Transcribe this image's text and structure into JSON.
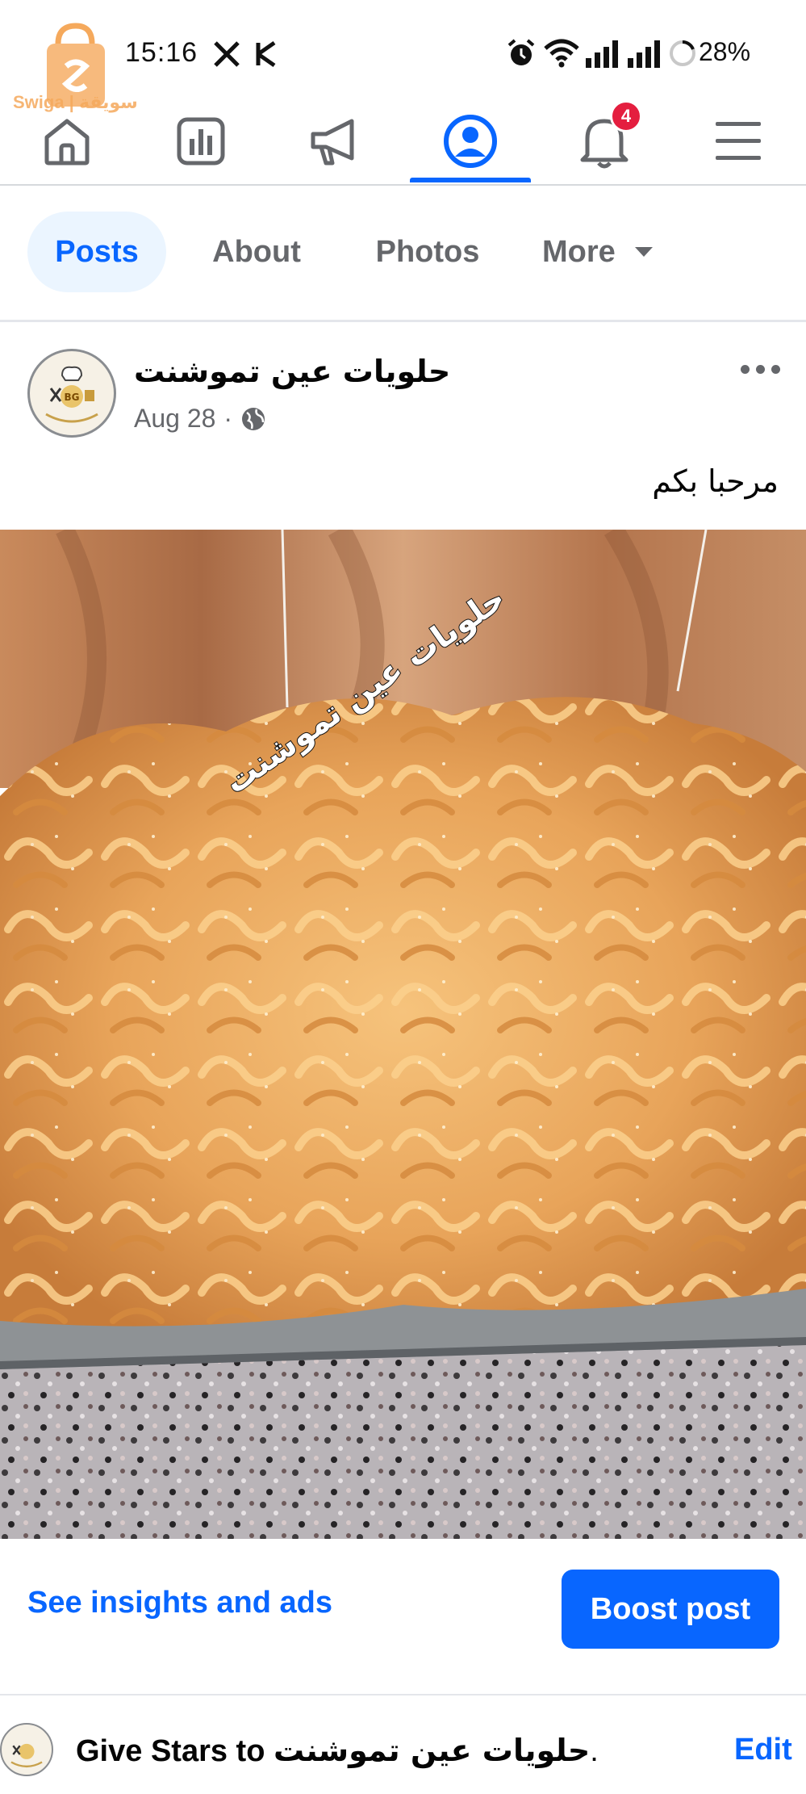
{
  "status_bar": {
    "time": "15:16",
    "battery": "28%",
    "icons": [
      "x-logo-icon",
      "k-app-icon",
      "alarm-icon",
      "wifi-icon",
      "signal-icon",
      "signal-icon-2",
      "battery-ring-icon"
    ]
  },
  "watermark": {
    "text": "Swiga | سويقة",
    "icon": "shopping-bag-logo-icon",
    "color": "#f5a95c"
  },
  "top_nav": {
    "items": [
      {
        "name": "home",
        "icon": "home-icon"
      },
      {
        "name": "dashboard",
        "icon": "bar-chart-icon"
      },
      {
        "name": "ads",
        "icon": "megaphone-icon"
      },
      {
        "name": "profile",
        "icon": "profile-icon",
        "active": true
      },
      {
        "name": "notifications",
        "icon": "bell-icon",
        "badge": "4"
      },
      {
        "name": "menu",
        "icon": "hamburger-menu-icon"
      }
    ],
    "accent": "#0866ff"
  },
  "profile_tabs": {
    "tabs": [
      {
        "label": "Posts",
        "active": true
      },
      {
        "label": "About"
      },
      {
        "label": "Photos"
      },
      {
        "label": "More"
      }
    ]
  },
  "post": {
    "author": "حلويات عين تموشنت",
    "date": "Aug 28",
    "separator": "·",
    "privacy_icon": "globe-icon",
    "text": "مرحبا بكم",
    "image_watermark": "حلويات عين تموشنت",
    "image_description_icon": "food-photo"
  },
  "actions": {
    "insights_label": "See insights and ads",
    "boost_label": "Boost post"
  },
  "stars_row": {
    "prefix": "Give Stars to",
    "name": "حلويات عين تموشنت",
    "suffix": ".",
    "edit_label": "Edit"
  }
}
